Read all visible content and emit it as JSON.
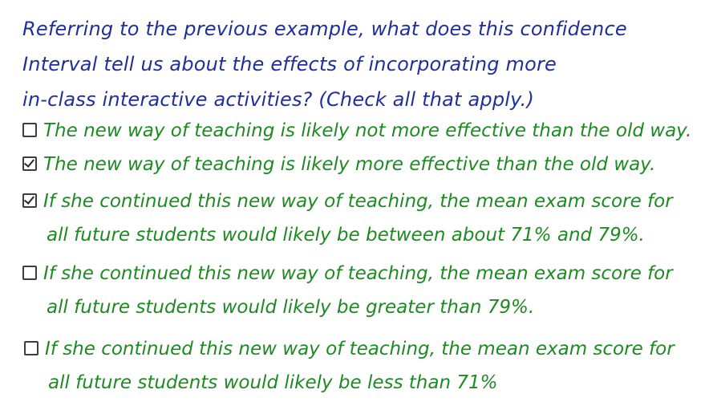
{
  "question": {
    "lines": [
      "Referring to the previous example, what does this confidence",
      "Interval tell us about the effects of incorporating more",
      "in-class interactive activities? (Check all that apply.)"
    ]
  },
  "options": [
    {
      "checked": false,
      "lines": [
        "The new way of teaching is likely not more effective than the old way."
      ]
    },
    {
      "checked": true,
      "lines": [
        "The new way of teaching is likely more effective than the old way."
      ]
    },
    {
      "checked": true,
      "lines": [
        "If she continued this new way of teaching, the mean exam score for",
        "all future students would likely be between about 71% and 79%."
      ]
    },
    {
      "checked": false,
      "lines": [
        "If she continued this new way of teaching, the mean exam score for",
        "all future students would likely be greater than 79%."
      ]
    },
    {
      "checked": false,
      "lines": [
        "If she continued this new way of teaching, the mean exam score for",
        "all future students would likely be less than 71%"
      ]
    }
  ],
  "colors": {
    "question_ink": "#1f2f9e",
    "answer_ink": "#1e8a22"
  }
}
